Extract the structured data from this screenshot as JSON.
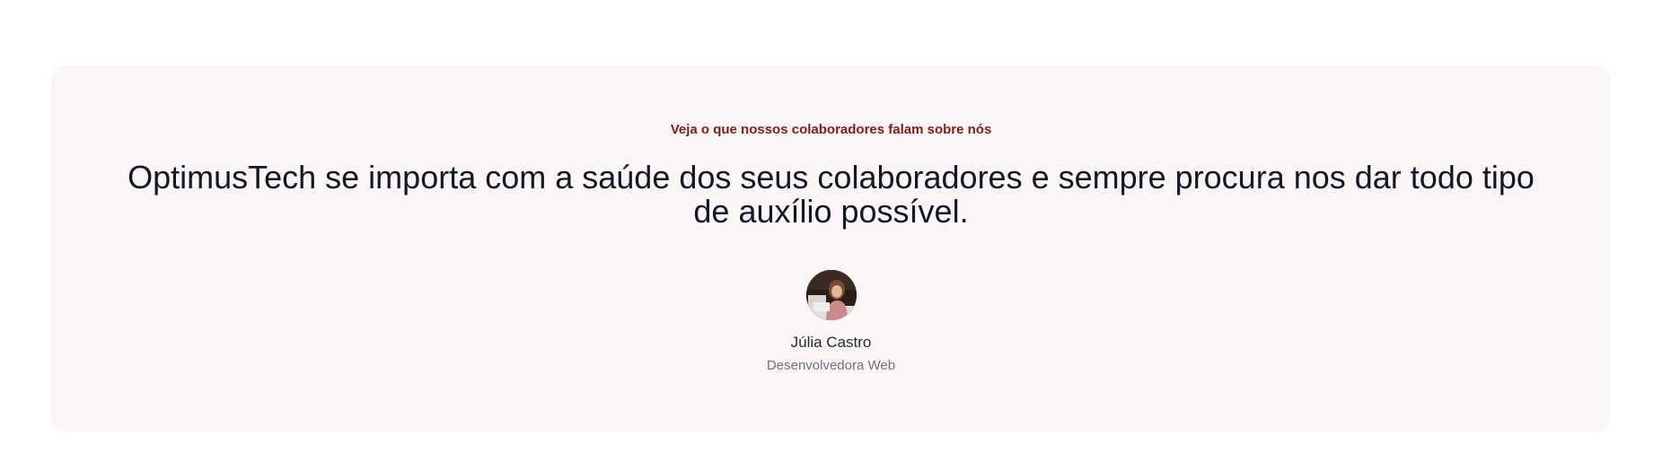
{
  "testimonial": {
    "eyebrow": "Veja o que nossos colaboradores falam sobre nós",
    "quote": "OptimusTech se importa com a saúde dos seus colaboradores e sempre procura nos dar todo tipo de auxílio possível.",
    "author": {
      "name": "Júlia Castro",
      "role": "Desenvolvedora Web",
      "avatar": "person-photo"
    }
  },
  "colors": {
    "card_background": "#fcf5f5",
    "eyebrow": "#7f1d1d",
    "quote": "#111827",
    "name": "#1f2937",
    "role": "#6b7280"
  }
}
